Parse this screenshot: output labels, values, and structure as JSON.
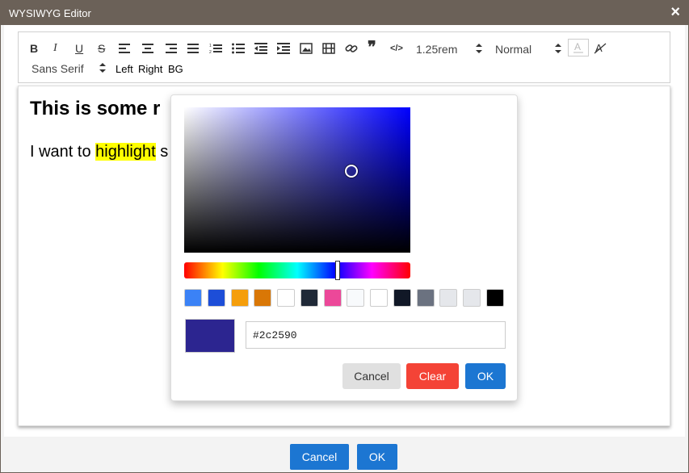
{
  "window": {
    "title": "WYSIWYG Editor",
    "close_icon": "×"
  },
  "toolbar": {
    "bold": "B",
    "italic": "I",
    "underline": "U",
    "strike": "S",
    "quote": "❞",
    "code": "</>",
    "font_size": "1.25rem",
    "heading": "Normal",
    "font_family": "Sans Serif",
    "align_left": "Left",
    "align_right": "Right",
    "bg": "BG"
  },
  "editor": {
    "heading": "This is some r",
    "para_before": "I want to ",
    "para_highlight": "highlight",
    "para_after": " s"
  },
  "color_picker": {
    "hex_value": "#2c2590",
    "hue_color": "#0000ff",
    "preview_color": "#2c2590",
    "swatches": [
      "#3b82f6",
      "#1d4ed8",
      "#f59e0b",
      "#d97706",
      "#ffffff",
      "#1f2937",
      "#ec4899",
      "#f8fafc",
      "#ffffff",
      "#111827",
      "#6b7280",
      "#e5e7eb",
      "#e5e7eb",
      "#000000"
    ],
    "cancel_label": "Cancel",
    "clear_label": "Clear",
    "ok_label": "OK"
  },
  "footer": {
    "cancel_label": "Cancel",
    "ok_label": "OK"
  }
}
